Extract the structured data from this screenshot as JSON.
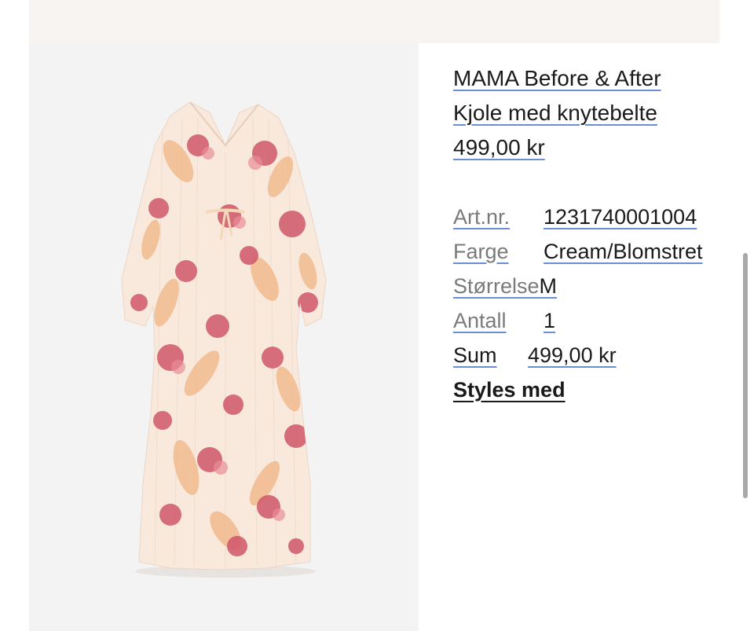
{
  "product": {
    "title_line1": "MAMA Before & After",
    "title_line2": "Kjole med knytebelte",
    "price": "499,00 kr",
    "image_alt": "floral-dress-image"
  },
  "details": {
    "article_label": "Art.nr.",
    "article_value": "1231740001004",
    "color_label": "Farge",
    "color_value": "Cream/Blomstret",
    "size_label": "Størrelse",
    "size_value": "M",
    "qty_label": "Antall",
    "qty_value": "1",
    "sum_label": "Sum",
    "sum_value": "499,00 kr"
  },
  "styles_link": "Styles med",
  "colors": {
    "link_underline": "#6b8fd6",
    "dress_base": "#f8e9dc",
    "flower_red": "#d0576a",
    "flower_peach": "#f1b88a"
  }
}
